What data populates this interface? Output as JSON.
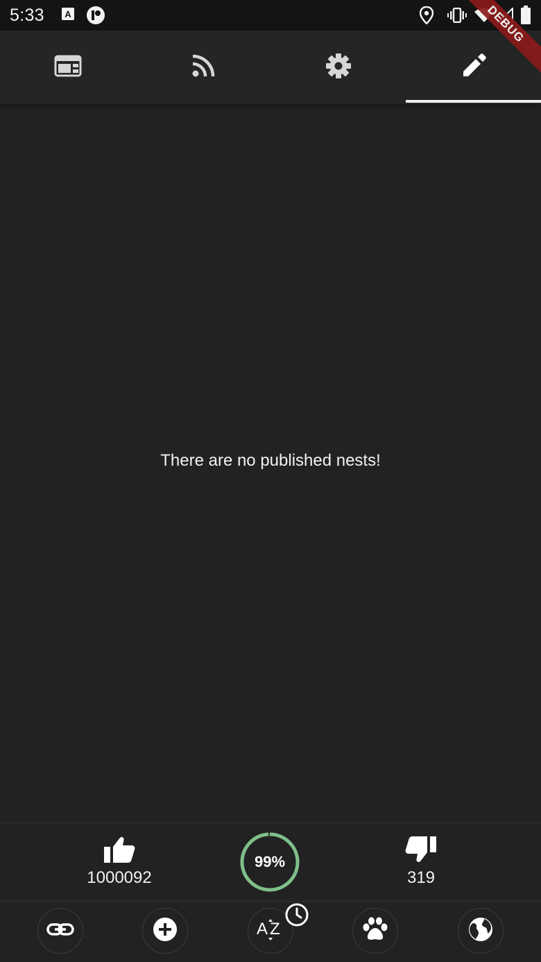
{
  "status_bar": {
    "time": "5:33",
    "icons": [
      "text-a-icon",
      "app-circle-icon",
      "location-icon",
      "vibrate-icon",
      "wifi-icon",
      "signal-icon",
      "battery-icon"
    ]
  },
  "debug_banner": "DEBUG",
  "tabs": [
    {
      "icon": "web-layout-icon",
      "selected": false
    },
    {
      "icon": "rss-feed-icon",
      "selected": false
    },
    {
      "icon": "settings-gear-icon",
      "selected": false
    },
    {
      "icon": "edit-pencil-icon",
      "selected": true
    }
  ],
  "main": {
    "empty_message": "There are no published nests!"
  },
  "votes": {
    "likes": "1000092",
    "rating": "99%",
    "rating_fraction": 0.99,
    "dislikes": "319"
  },
  "actions": [
    {
      "icon": "link-icon"
    },
    {
      "icon": "add-circle-icon"
    },
    {
      "icon": "sort-az-icon",
      "badge_icon": "clock-icon"
    },
    {
      "icon": "paw-icon"
    },
    {
      "icon": "globe-icon"
    }
  ],
  "colors": {
    "background": "#222222",
    "tab_bar": "#252525",
    "status_bar": "#141414",
    "rating_ring": "#7fbf8a",
    "debug_banner": "#8b1a1a"
  }
}
